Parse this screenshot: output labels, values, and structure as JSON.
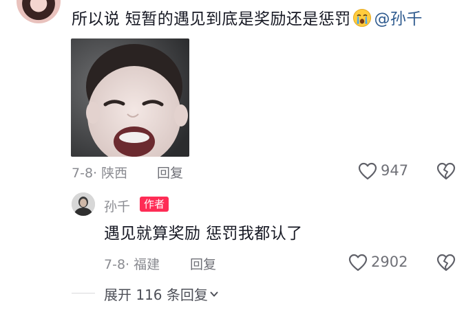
{
  "comment": {
    "text": "所以说 短暂的遇见到底是奖励还是惩罚",
    "emoji_icon": "crying-face-emoji",
    "mention": "@孙千",
    "meta": "7-8· 陕西",
    "reply_label": "回复",
    "like_count": "947",
    "like_icon": "heart-outline-icon",
    "dislike_icon": "broken-heart-icon"
  },
  "reply": {
    "username": "孙千",
    "badge": "作者",
    "text": "遇见就算奖励 惩罚我都认了",
    "meta": "7-8· 福建",
    "reply_label": "回复",
    "like_count": "2902"
  },
  "expand": {
    "label": "展开 116 条回复",
    "icon": "chevron-down-icon"
  },
  "colors": {
    "mention": "#2e5a8e",
    "badge": "#fe2c55",
    "meta": "#8a8b91"
  }
}
